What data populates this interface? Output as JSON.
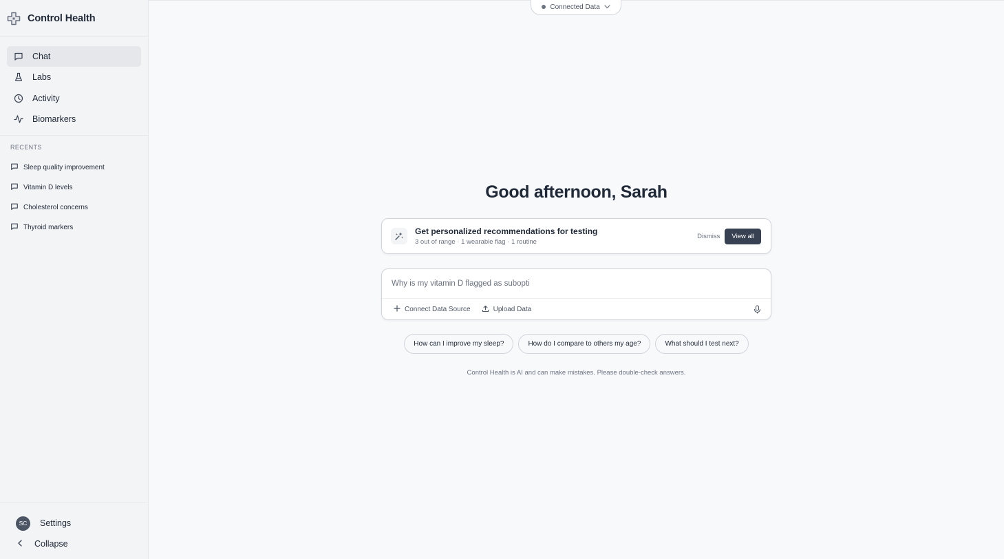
{
  "brand": {
    "name": "Control Health",
    "logo_icon": "medical-cross-icon"
  },
  "nav": {
    "items": [
      {
        "label": "Chat",
        "icon": "chat-icon",
        "active": true
      },
      {
        "label": "Labs",
        "icon": "flask-icon",
        "active": false
      },
      {
        "label": "Activity",
        "icon": "clock-icon",
        "active": false
      },
      {
        "label": "Biomarkers",
        "icon": "pulse-icon",
        "active": false
      }
    ]
  },
  "recents": {
    "title": "RECENTS",
    "items": [
      {
        "label": "Sleep quality improvement"
      },
      {
        "label": "Vitamin D levels"
      },
      {
        "label": "Cholesterol concerns"
      },
      {
        "label": "Thyroid markers"
      }
    ]
  },
  "footer": {
    "avatar_initials": "SC",
    "settings_label": "Settings",
    "collapse_label": "Collapse"
  },
  "header": {
    "connected_label": "Connected Data"
  },
  "main": {
    "greeting": "Good afternoon, Sarah",
    "recommendation": {
      "title": "Get personalized recommendations for testing",
      "subtitle": "3 out of range · 1 wearable flag · 1 routine",
      "dismiss_label": "Dismiss",
      "view_all_label": "View all"
    },
    "composer": {
      "input_text": "Why is my vitamin D flagged as subopti",
      "connect_label": "Connect Data Source",
      "upload_label": "Upload Data"
    },
    "suggestions": [
      "How can I improve my sleep?",
      "How do I compare to others my age?",
      "What should I test next?"
    ],
    "disclaimer": "Control Health is AI and can make mistakes. Please double-check answers."
  },
  "colors": {
    "accent_dark": "#374151",
    "sidebar_bg": "#f3f4f6",
    "page_bg": "#f8f9fb"
  }
}
